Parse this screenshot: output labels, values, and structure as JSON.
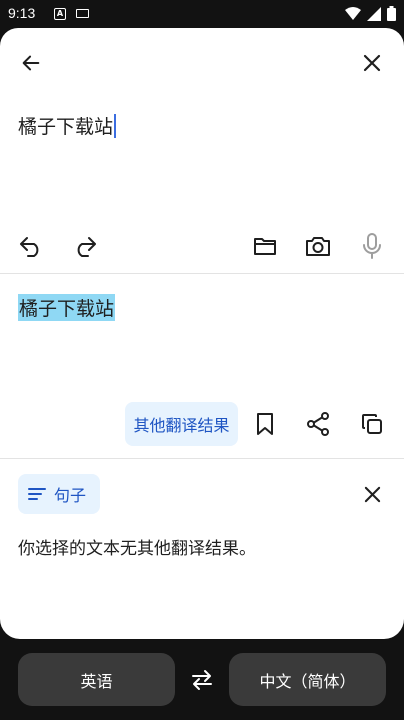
{
  "status": {
    "time": "9:13",
    "notif_letter": "A"
  },
  "source": {
    "text": "橘子下载站"
  },
  "result": {
    "text": "橘子下载站",
    "other_label": "其他翻译结果"
  },
  "panel": {
    "chip_label": "句子",
    "message": "你选择的文本无其他翻译结果。"
  },
  "languages": {
    "source": "英语",
    "target": "中文（简体）"
  },
  "icons": [
    "back-arrow-icon",
    "close-icon",
    "undo-icon",
    "redo-icon",
    "folder-icon",
    "camera-icon",
    "mic-icon",
    "bookmark-icon",
    "share-icon",
    "copy-icon",
    "lines-icon",
    "swap-icon"
  ],
  "colors": {
    "accent": "#1f55c3",
    "chip_bg": "#e7f3fe",
    "highlight": "#8fd8f4",
    "cursor": "#3b6de0"
  }
}
